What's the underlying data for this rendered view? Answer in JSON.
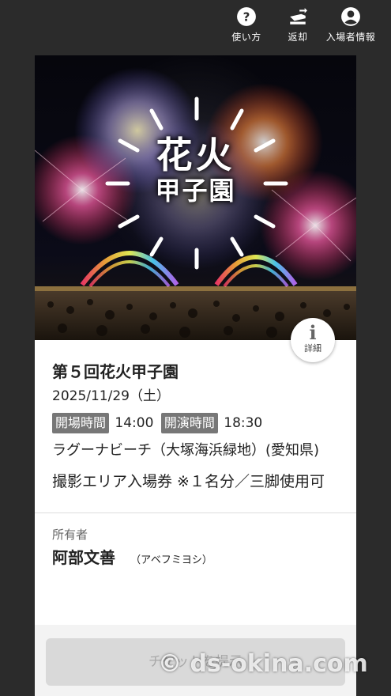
{
  "topbar": {
    "items": [
      {
        "label": "使い方",
        "icon": "help-circle-icon"
      },
      {
        "label": "返却",
        "icon": "ticket-return-icon"
      },
      {
        "label": "入場者情報",
        "icon": "account-circle-icon"
      }
    ]
  },
  "hero": {
    "logo_top": "花火",
    "logo_bottom": "甲子園",
    "info_label": "詳細"
  },
  "event": {
    "title": "第５回花火甲子園",
    "date": "2025/11/29（土）",
    "open_label": "開場時間",
    "open_time": "14:00",
    "start_label": "開演時間",
    "start_time": "18:30",
    "venue": "ラグーナビーチ（大塚海浜緑地）(愛知県)",
    "ticket_type": "撮影エリア入場券 ※１名分／三脚使用可"
  },
  "owner": {
    "label": "所有者",
    "name": "阿部文善",
    "kana": "（アベフミヨシ）"
  },
  "footer": {
    "present_button": "チケットを提示"
  },
  "watermark": "© ds-okina.com",
  "colors": {
    "background": "#2b2b2b",
    "badge": "#777777",
    "button_disabled": "#d9d9d9"
  }
}
